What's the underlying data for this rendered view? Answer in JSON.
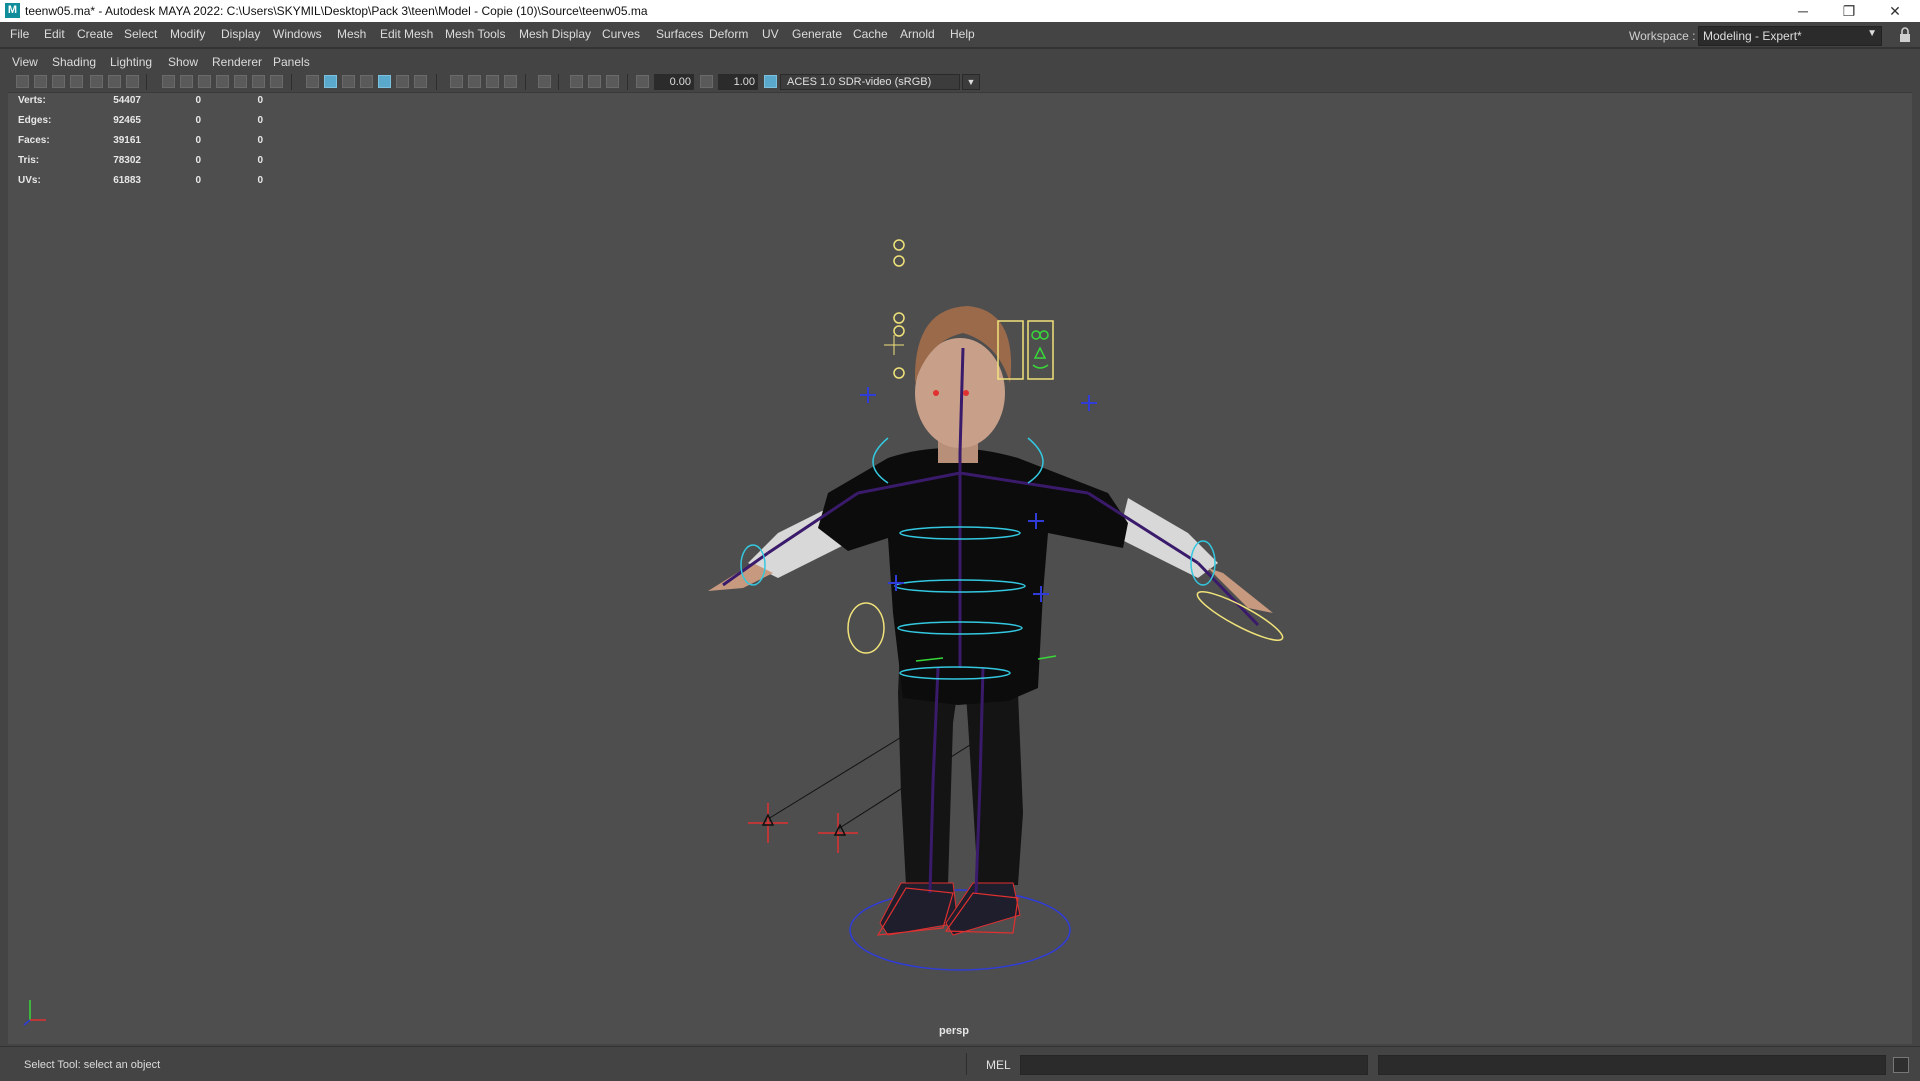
{
  "window": {
    "title": "teenw05.ma* - Autodesk MAYA 2022: C:\\Users\\SKYMIL\\Desktop\\Pack 3\\teen\\Model - Copie (10)\\Source\\teenw05.ma",
    "logo_letter": "M",
    "controls": {
      "minimize": "─",
      "restore": "❐",
      "close": "✕"
    }
  },
  "menubar": {
    "items": [
      "File",
      "Edit",
      "Create",
      "Select",
      "Modify",
      "Display",
      "Windows",
      "Mesh",
      "Edit Mesh",
      "Mesh Tools",
      "Mesh Display",
      "Curves",
      "Surfaces",
      "Deform",
      "UV",
      "Generate",
      "Cache",
      "Arnold",
      "Help"
    ]
  },
  "workspace": {
    "label": "Workspace :",
    "value": "Modeling - Expert*",
    "arrow": "▼"
  },
  "panel_menu": {
    "items": [
      "View",
      "Shading",
      "Lighting",
      "Show",
      "Renderer",
      "Panels"
    ]
  },
  "toolbar": {
    "near_value": "0.00",
    "gamma_value": "1.00",
    "color_space": "ACES 1.0 SDR-video (sRGB)",
    "dropdown_arrow": "▼"
  },
  "hud": {
    "rows": [
      {
        "label": "Verts:",
        "v1": "54407",
        "v2": "0",
        "v3": "0"
      },
      {
        "label": "Edges:",
        "v1": "92465",
        "v2": "0",
        "v3": "0"
      },
      {
        "label": "Faces:",
        "v1": "39161",
        "v2": "0",
        "v3": "0"
      },
      {
        "label": "Tris:",
        "v1": "78302",
        "v2": "0",
        "v3": "0"
      },
      {
        "label": "UVs:",
        "v1": "61883",
        "v2": "0",
        "v3": "0"
      }
    ]
  },
  "viewport": {
    "camera_label": "persp"
  },
  "status": {
    "message": "Select Tool: select an object",
    "command_language": "MEL"
  },
  "colors": {
    "viewport_bg": "#4e4e4e",
    "rig_purple": "#3a1a6a",
    "rig_cyan": "#33c8e0",
    "rig_yellow": "#f0e27a",
    "rig_blue": "#2f3cd8",
    "rig_red": "#e03030",
    "rig_green": "#38d838",
    "accent": "#5aa9cc"
  }
}
